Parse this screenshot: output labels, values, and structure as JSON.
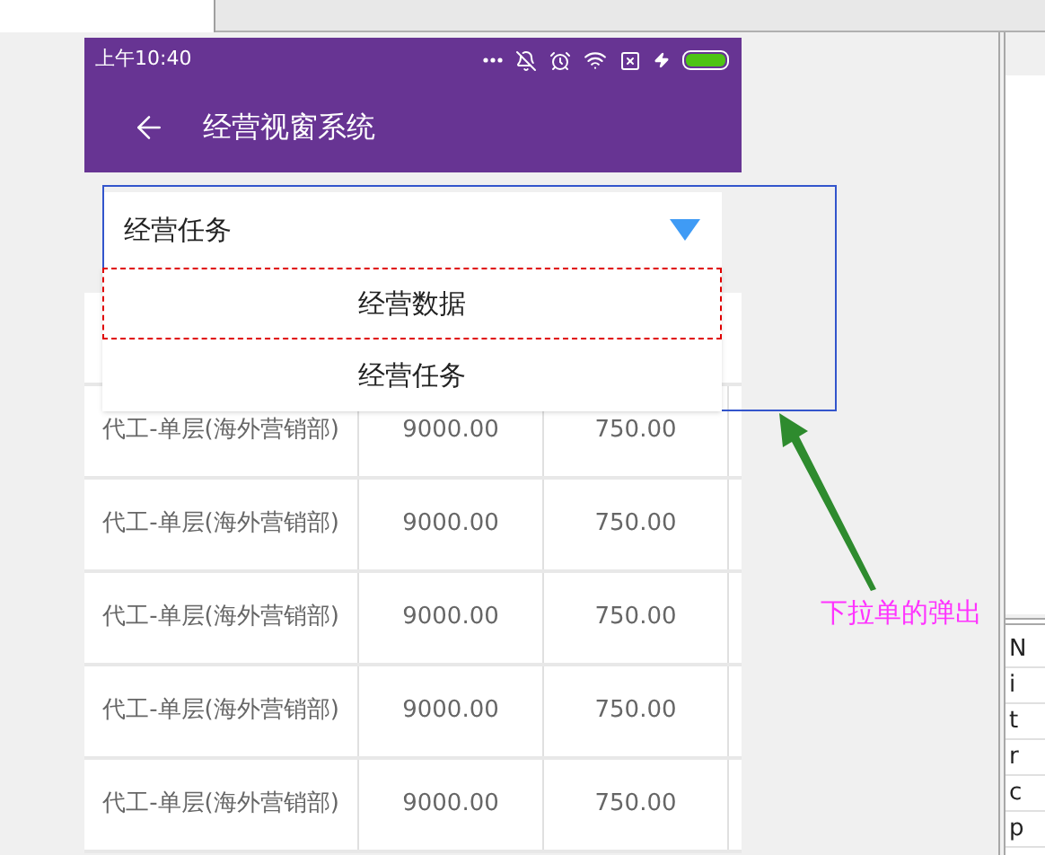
{
  "status_bar": {
    "time": "上午10:40"
  },
  "app_bar": {
    "title": "经营视窗系统"
  },
  "spinner": {
    "value": "经营任务"
  },
  "dropdown": {
    "items": [
      {
        "label": "经营数据",
        "highlighted": true
      },
      {
        "label": "经营任务",
        "highlighted": false
      }
    ]
  },
  "table": {
    "rows": [
      [
        "代工-单层(海外营销部)",
        "9000.00",
        "750.00"
      ],
      [
        "代工-单层(海外营销部)",
        "9000.00",
        "750.00"
      ],
      [
        "代工-单层(海外营销部)",
        "9000.00",
        "750.00"
      ],
      [
        "代工-单层(海外营销部)",
        "9000.00",
        "750.00"
      ],
      [
        "代工-单层(海外营销部)",
        "9000.00",
        "750.00"
      ]
    ]
  },
  "annotation": {
    "label": "下拉单的弹出"
  },
  "side_panel": {
    "lines": [
      "N",
      "i",
      "t",
      "r",
      "c",
      "p"
    ]
  }
}
